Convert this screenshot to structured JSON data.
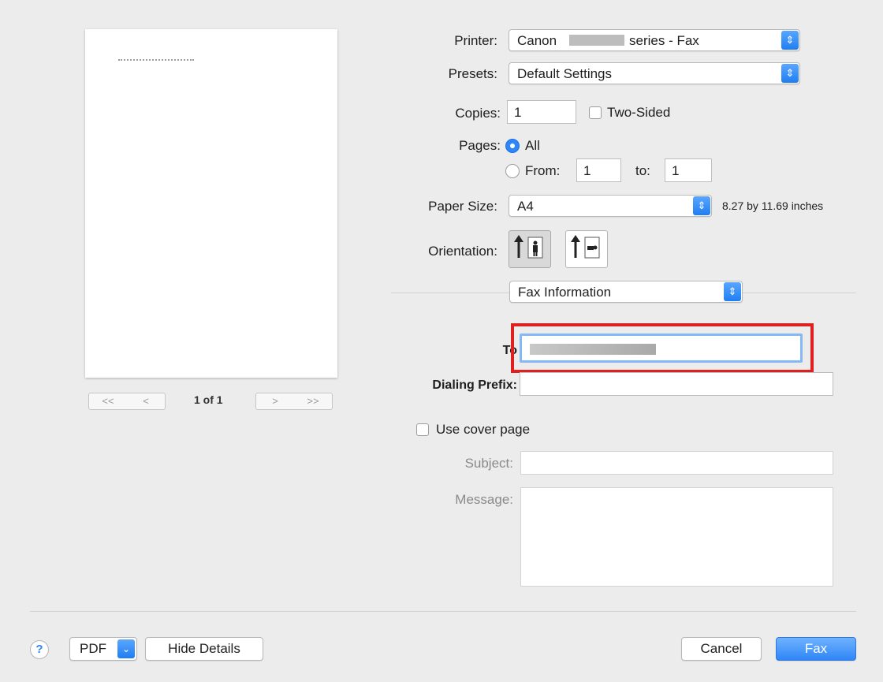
{
  "preview": {
    "page_indicator": "1 of 1",
    "nav_first": "<<",
    "nav_prev": "<",
    "nav_next": ">",
    "nav_last": ">>"
  },
  "printer": {
    "label": "Printer:",
    "value_prefix": "Canon",
    "value_suffix": "series - Fax"
  },
  "presets": {
    "label": "Presets:",
    "value": "Default Settings"
  },
  "copies": {
    "label": "Copies:",
    "value": "1",
    "two_sided_label": "Two-Sided",
    "two_sided_checked": false
  },
  "pages": {
    "label": "Pages:",
    "all_label": "All",
    "from_label": "From:",
    "from_value": "1",
    "to_label": "to:",
    "to_value": "1",
    "selected": "All"
  },
  "paper_size": {
    "label": "Paper Size:",
    "value": "A4",
    "dimensions": "8.27 by 11.69 inches"
  },
  "orientation": {
    "label": "Orientation:",
    "selected": "portrait"
  },
  "section_popup": {
    "value": "Fax Information"
  },
  "fax": {
    "to_label": "To",
    "dialing_prefix_label": "Dialing Prefix:",
    "dialing_prefix_value": "",
    "use_cover_page_label": "Use cover page",
    "use_cover_page_checked": false,
    "subject_label": "Subject:",
    "subject_value": "",
    "message_label": "Message:",
    "message_value": ""
  },
  "footer": {
    "help": "?",
    "pdf": "PDF",
    "hide_details": "Hide Details",
    "cancel": "Cancel",
    "fax": "Fax"
  },
  "colors": {
    "accent": "#2f86f6",
    "highlight_box": "#e02020"
  },
  "icons": [
    "question-icon",
    "chevron-down-icon",
    "stepper-icon",
    "portrait-icon",
    "landscape-icon",
    "radio-icon",
    "checkbox-icon"
  ]
}
